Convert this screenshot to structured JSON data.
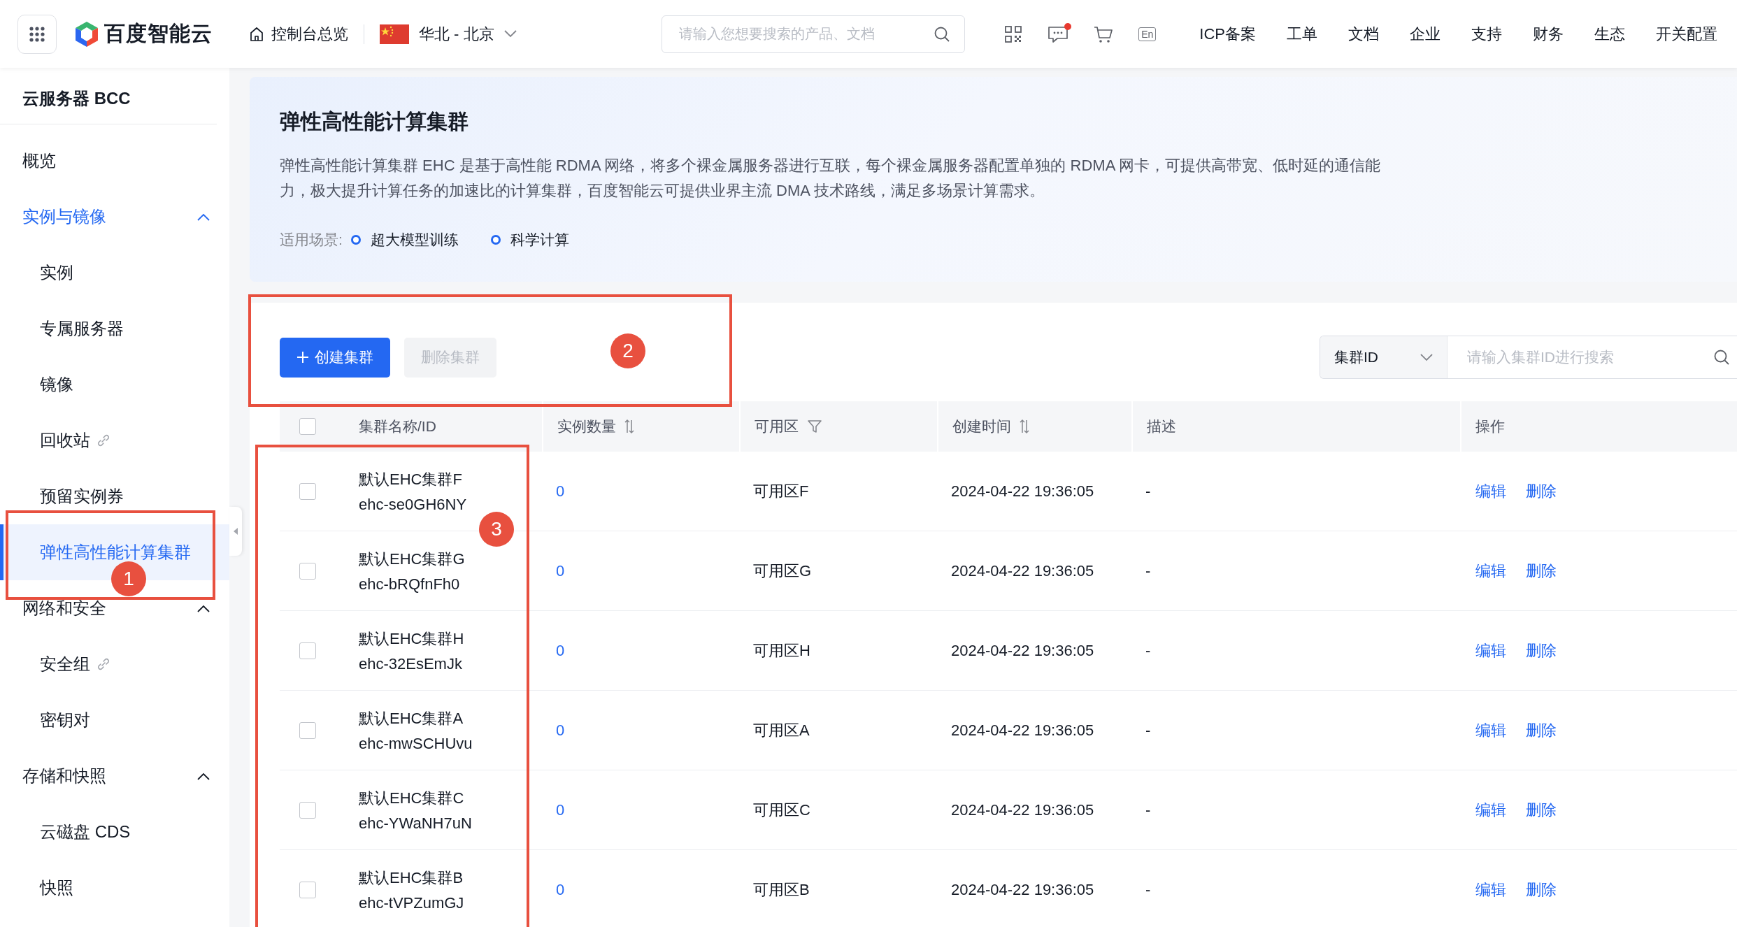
{
  "top_bar": {
    "brand": "百度智能云",
    "console": "控制台总览",
    "region": "华北 - 北京",
    "search": {
      "placeholder": "请输入您想要搜索的产品、文档"
    },
    "message_unread": true,
    "language": "En",
    "links": [
      "ICP备案",
      "工单",
      "文档",
      "企业",
      "支持",
      "财务",
      "生态",
      "开关配置"
    ]
  },
  "sidebar": {
    "title": "云服务器 BCC",
    "items": [
      {
        "kind": "item",
        "label": "概览",
        "selected": false
      },
      {
        "kind": "group",
        "label": "实例与镜像",
        "expanded": true,
        "children": [
          {
            "label": "实例",
            "external": false,
            "selected": false
          },
          {
            "label": "专属服务器",
            "external": false,
            "selected": false
          },
          {
            "label": "镜像",
            "external": false,
            "selected": false
          },
          {
            "label": "回收站",
            "external": true,
            "selected": false
          },
          {
            "label": "预留实例券",
            "external": false,
            "selected": false
          },
          {
            "label": "弹性高性能计算集群",
            "external": false,
            "selected": true
          }
        ]
      },
      {
        "kind": "group",
        "label": "网络和安全",
        "expanded": true,
        "children": [
          {
            "label": "安全组",
            "external": true,
            "selected": false
          },
          {
            "label": "密钥对",
            "external": false,
            "selected": false
          }
        ]
      },
      {
        "kind": "group",
        "label": "存储和快照",
        "expanded": true,
        "children": [
          {
            "label": "云磁盘 CDS",
            "external": false,
            "selected": false
          },
          {
            "label": "快照",
            "external": false,
            "selected": false
          }
        ]
      }
    ]
  },
  "banner": {
    "title": "弹性高性能计算集群",
    "description": "弹性高性能计算集群 EHC 是基于高性能 RDMA 网络，将多个裸金属服务器进行互联，每个裸金属服务器配置单独的 RDMA 网卡，可提供高带宽、低时延的通信能力，极大提升计算任务的加速比的计算集群，百度智能云可提供业界主流 DMA 技术路线，满足多场景计算需求。",
    "scenarios_label": "适用场景:",
    "scenarios": [
      "超大模型训练",
      "科学计算"
    ]
  },
  "toolbar": {
    "buttons": [
      {
        "label": "创建集群",
        "kind": "primary",
        "disabled": false
      },
      {
        "label": "删除集群",
        "kind": "default",
        "disabled": true
      }
    ],
    "filter_select": "集群ID",
    "search": {
      "placeholder": "请输入集群ID进行搜索"
    }
  },
  "table": {
    "header_checked": false,
    "columns": [
      {
        "label": "集群名称/ID",
        "kind": "plain"
      },
      {
        "label": "实例数量",
        "kind": "sortable"
      },
      {
        "label": "可用区",
        "kind": "filter"
      },
      {
        "label": "创建时间",
        "kind": "sortable"
      },
      {
        "label": "描述",
        "kind": "plain"
      },
      {
        "label": "操作",
        "kind": "plain"
      }
    ],
    "rows": [
      {
        "checked": false,
        "name": "默认EHC集群F",
        "id": "ehc-se0GH6NY",
        "instances": "0",
        "zone": "可用区F",
        "created": "2024-04-22 19:36:05",
        "description": "-",
        "actions": [
          "编辑",
          "删除"
        ]
      },
      {
        "checked": false,
        "name": "默认EHC集群G",
        "id": "ehc-bRQfnFh0",
        "instances": "0",
        "zone": "可用区G",
        "created": "2024-04-22 19:36:05",
        "description": "-",
        "actions": [
          "编辑",
          "删除"
        ]
      },
      {
        "checked": false,
        "name": "默认EHC集群H",
        "id": "ehc-32EsEmJk",
        "instances": "0",
        "zone": "可用区H",
        "created": "2024-04-22 19:36:05",
        "description": "-",
        "actions": [
          "编辑",
          "删除"
        ]
      },
      {
        "checked": false,
        "name": "默认EHC集群A",
        "id": "ehc-mwSCHUvu",
        "instances": "0",
        "zone": "可用区A",
        "created": "2024-04-22 19:36:05",
        "description": "-",
        "actions": [
          "编辑",
          "删除"
        ]
      },
      {
        "checked": false,
        "name": "默认EHC集群C",
        "id": "ehc-YWaNH7uN",
        "instances": "0",
        "zone": "可用区C",
        "created": "2024-04-22 19:36:05",
        "description": "-",
        "actions": [
          "编辑",
          "删除"
        ]
      },
      {
        "checked": false,
        "name": "默认EHC集群B",
        "id": "ehc-tVPZumGJ",
        "instances": "0",
        "zone": "可用区B",
        "created": "2024-04-22 19:36:05",
        "description": "-",
        "actions": [
          "编辑",
          "删除"
        ]
      }
    ]
  },
  "annotations": [
    {
      "label": "1"
    },
    {
      "label": "2"
    },
    {
      "label": "3"
    }
  ]
}
